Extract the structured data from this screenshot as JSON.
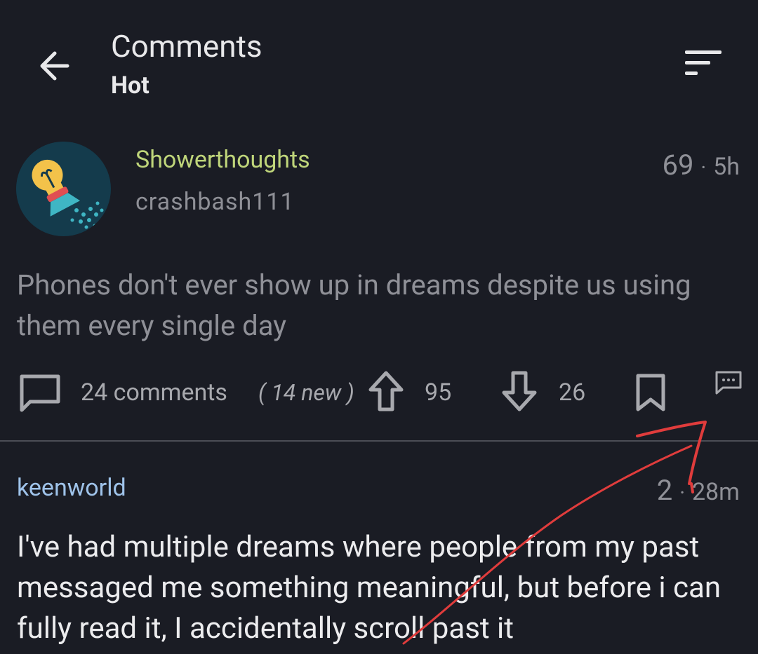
{
  "header": {
    "title": "Comments",
    "sort_mode": "Hot"
  },
  "post": {
    "subreddit": "Showerthoughts",
    "author": "crashbash111",
    "score": "69",
    "separator": "·",
    "age": "5h",
    "title": "Phones don't ever show up in dreams despite us using them every single day",
    "comments_label": "24 comments",
    "new_comments_label": "( 14 new )",
    "upvotes": "95",
    "downvotes": "26"
  },
  "comment": {
    "author": "keenworld",
    "score": "2",
    "separator": "·",
    "age": "28m",
    "body": "I've had multiple dreams where people from my past messaged me something meaningful, but before i can fully read it, I accidentally scroll past it"
  },
  "colors": {
    "background": "#1a1c24",
    "subreddit": "#bfd57a",
    "comment_author": "#9fc3ea",
    "annotation": "#e03c3c"
  },
  "icons": {
    "back": "arrow-left-icon",
    "sort": "sort-icon",
    "comments": "comment-bubble-icon",
    "upvote": "arrow-up-icon",
    "downvote": "arrow-down-icon",
    "save": "bookmark-icon",
    "reply": "reply-bubble-icon"
  }
}
